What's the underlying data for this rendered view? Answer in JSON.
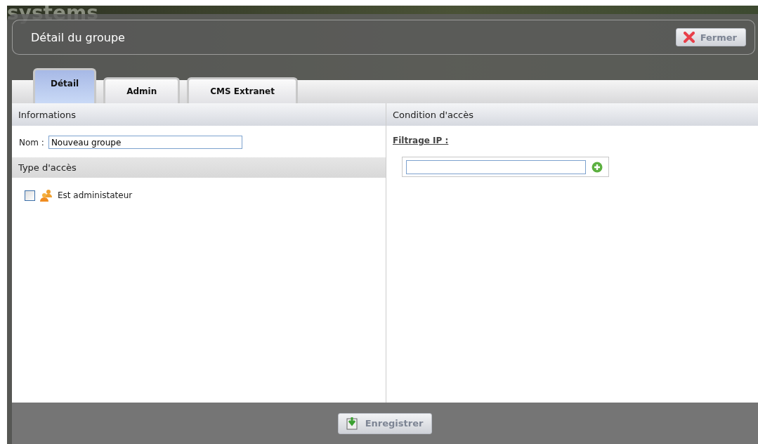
{
  "background": {
    "brand": "systems"
  },
  "dialog": {
    "title": "Détail du groupe",
    "close_button": "Fermer"
  },
  "tabs": [
    {
      "label": "Détail",
      "selected": true
    },
    {
      "label": "Admin",
      "selected": false
    },
    {
      "label": "CMS Extranet",
      "selected": false
    }
  ],
  "informations": {
    "heading": "Informations",
    "name_label": "Nom :",
    "name_value": "Nouveau groupe"
  },
  "access_type": {
    "heading": "Type d'accès",
    "options": [
      {
        "label": "Est administateur",
        "checked": false
      }
    ]
  },
  "access_condition": {
    "heading": "Condition d'accès",
    "ip_filter_label": "Filtrage IP :"
  },
  "footer": {
    "save_button": "Enregistrer"
  }
}
